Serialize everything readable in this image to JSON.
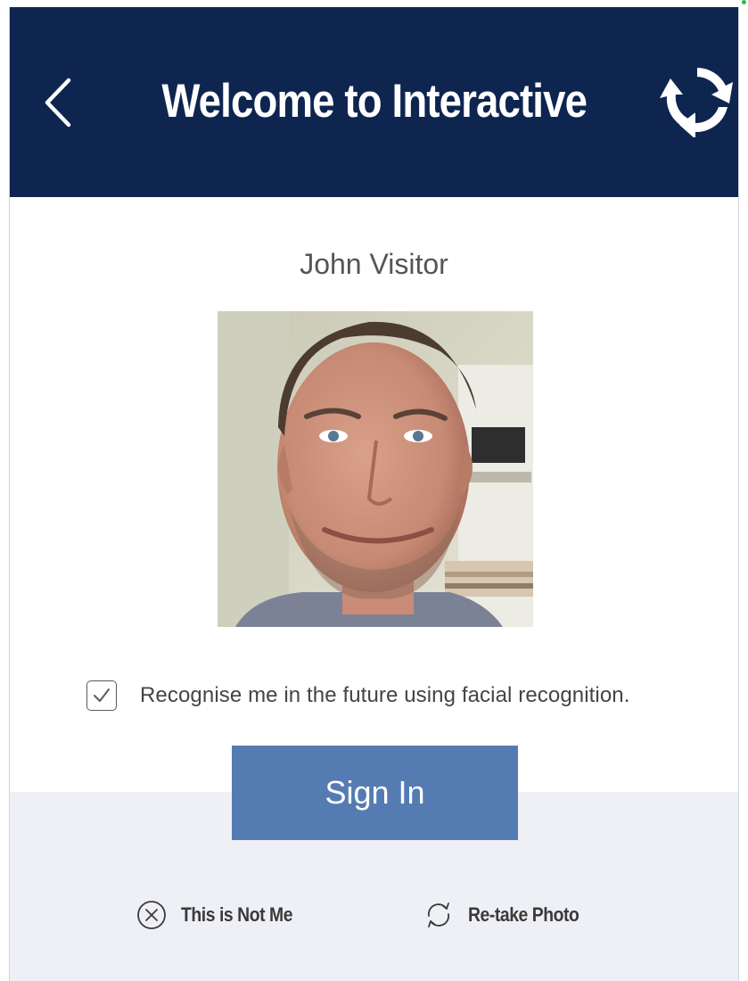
{
  "header": {
    "title": "Welcome to Interactive",
    "back_icon": "chevron-left-icon",
    "brand_icon": "recycle-arrows-logo-icon",
    "background_color": "#0e2550"
  },
  "visitor": {
    "name": "John Visitor"
  },
  "recognition": {
    "checked": true,
    "label": "Recognise me in the future using facial recognition."
  },
  "actions": {
    "sign_in_label": "Sign In",
    "sign_in_color": "#557cb2",
    "not_me_label": "This is Not Me",
    "not_me_icon": "circle-x-icon",
    "retake_label": "Re-take Photo",
    "retake_icon": "refresh-icon"
  },
  "footer": {
    "background_color": "#eff0f5"
  }
}
